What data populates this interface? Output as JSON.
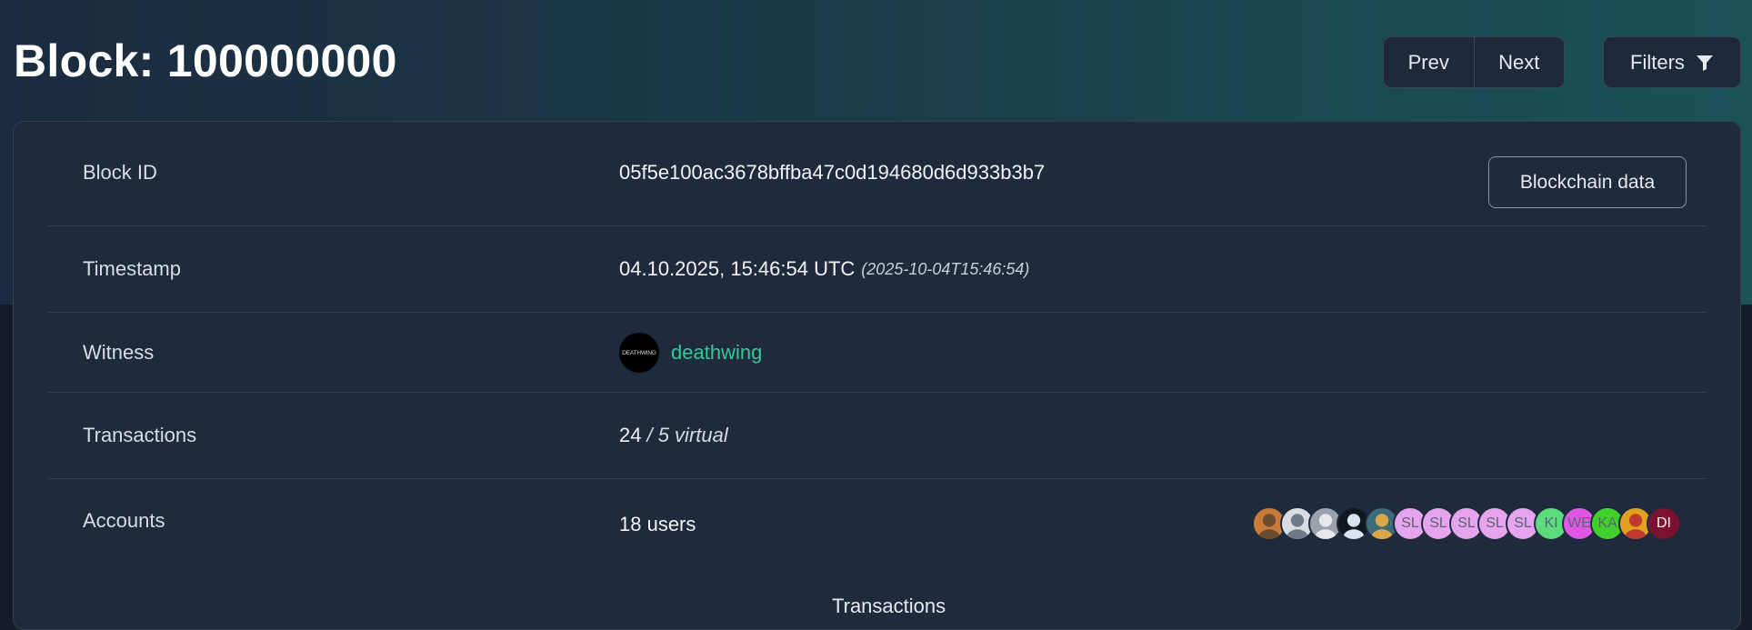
{
  "page": {
    "title": "Block: 100000000"
  },
  "nav": {
    "prev_label": "Prev",
    "next_label": "Next",
    "filters_label": "Filters"
  },
  "details": {
    "block_id": {
      "label": "Block ID",
      "value": "05f5e100ac3678bffba47c0d194680d6d933b3b7",
      "button_label": "Blockchain data"
    },
    "timestamp": {
      "label": "Timestamp",
      "value": "04.10.2025, 15:46:54 UTC",
      "iso": "(2025-10-04T15:46:54)"
    },
    "witness": {
      "label": "Witness",
      "name": "deathwing",
      "avatar_text": "DEATHWING"
    },
    "transactions": {
      "label": "Transactions",
      "count": "24",
      "virtual": "/ 5 virtual"
    },
    "accounts": {
      "label": "Accounts",
      "value": "18 users",
      "avatars": [
        {
          "icon": "user-avatar-image"
        },
        {
          "icon": "user-avatar-image"
        },
        {
          "icon": "user-avatar-image"
        },
        {
          "icon": "user-avatar-image"
        },
        {
          "icon": "user-avatar-image"
        },
        {
          "initials": "SL",
          "color": "#e7a4ee"
        },
        {
          "initials": "SL",
          "color": "#e7a4ee"
        },
        {
          "initials": "SL",
          "color": "#e7a4ee"
        },
        {
          "initials": "SL",
          "color": "#e7a4ee"
        },
        {
          "initials": "SL",
          "color": "#e7a4ee"
        },
        {
          "initials": "KI",
          "color": "#5bdb7c"
        },
        {
          "initials": "WE",
          "color": "#e057e6"
        },
        {
          "initials": "KA",
          "color": "#3fd02c"
        },
        {
          "icon": "user-avatar-image"
        },
        {
          "initials": "DI",
          "color": "#7b1230"
        }
      ]
    }
  },
  "section": {
    "peek_label": "Transactions"
  },
  "colors": {
    "accent": "#34c89a",
    "card_bg": "#1f2a3c",
    "border": "#334054"
  }
}
